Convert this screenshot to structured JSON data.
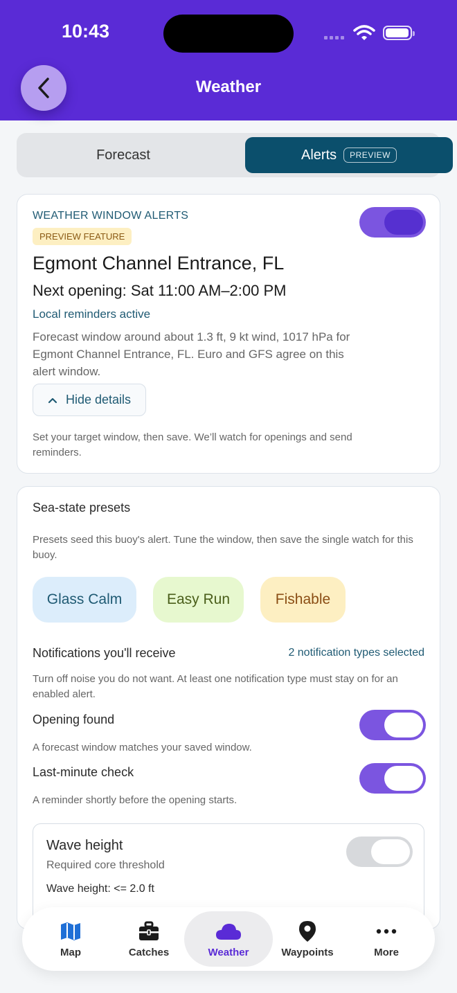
{
  "status": {
    "time": "10:43"
  },
  "header": {
    "title": "Weather"
  },
  "segmented": {
    "forecast": "Forecast",
    "alerts": "Alerts",
    "preview_tag": "PREVIEW"
  },
  "alert_card": {
    "eyebrow": "WEATHER WINDOW ALERTS",
    "badge": "PREVIEW FEATURE",
    "location": "Egmont Channel Entrance, FL",
    "next_opening": "Next opening: Sat 11:00 AM–2:00 PM",
    "local_reminders": "Local reminders active",
    "description": "Forecast window around about 1.3 ft, 9 kt wind, 1017 hPa for Egmont Channel Entrance, FL. Euro and GFS agree on this alert window.",
    "hide_details": "Hide details",
    "help": "Set your target window, then save. We’ll watch for openings and send reminders.",
    "enabled": true
  },
  "presets_card": {
    "title": "Sea-state presets",
    "description": "Presets seed this buoy's alert. Tune the window, then save the single watch for this buoy.",
    "presets": [
      "Glass Calm",
      "Easy Run",
      "Fishable"
    ],
    "notifications_title": "Notifications you'll receive",
    "notifications_count": "2 notification types selected",
    "notifications_desc": "Turn off noise you do not want. At least one notification type must stay on for an enabled alert.",
    "options": [
      {
        "label": "Opening found",
        "desc": "A forecast window matches your saved window.",
        "enabled": true
      },
      {
        "label": "Last-minute check",
        "desc": "A reminder shortly before the opening starts.",
        "enabled": true
      }
    ],
    "threshold": {
      "title": "Wave height",
      "subtitle": "Required core threshold",
      "value": "Wave height: <= 2.0 ft",
      "enabled": false
    }
  },
  "tabbar": {
    "items": [
      {
        "label": "Map",
        "icon": "map-icon"
      },
      {
        "label": "Catches",
        "icon": "briefcase-icon"
      },
      {
        "label": "Weather",
        "icon": "cloud-icon",
        "active": true
      },
      {
        "label": "Waypoints",
        "icon": "location-pin-icon"
      },
      {
        "label": "More",
        "icon": "more-dots-icon"
      }
    ]
  },
  "colors": {
    "brand": "#5a2bd6",
    "teal": "#0b4f6c",
    "toggle_on": "#7b55e0"
  }
}
